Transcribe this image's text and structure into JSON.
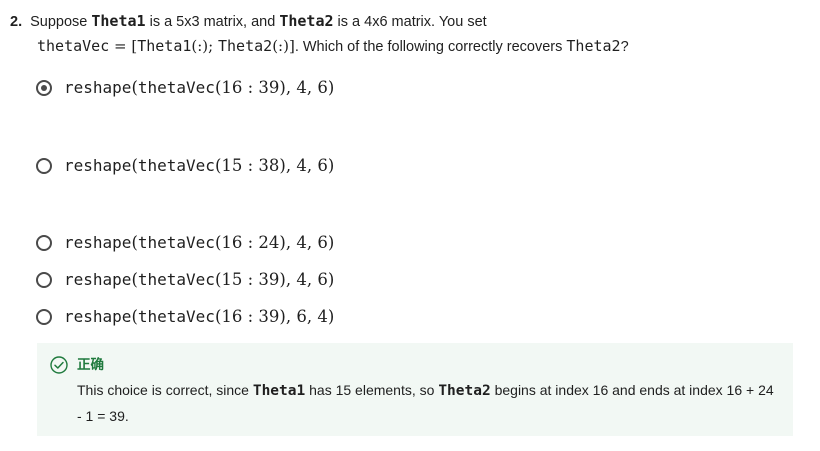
{
  "question": {
    "number": "2.",
    "line1": {
      "t1": "Suppose ",
      "m1": "Theta1",
      "t2": " is a 5x3 matrix, and ",
      "m2": "Theta2",
      "t3": " is a 4x6 matrix. You set"
    },
    "line2": {
      "m_var": "thetaVec",
      "eq": " = ",
      "bracket_open": "[",
      "m_a": "Theta1",
      "colon_a": "(:)",
      "sep": "; ",
      "m_b": "Theta2",
      "colon_b": "(:)",
      "bracket_close": "]",
      "t_end": ". Which of the following correctly recovers ",
      "m_end": "Theta2",
      "q_mark": "?"
    }
  },
  "options": [
    {
      "fn": "reshape",
      "arg_open": "(",
      "var": "thetaVec",
      "range": "(16 : 39), 4, 6)",
      "selected": true
    },
    {
      "fn": "reshape",
      "arg_open": "(",
      "var": "thetaVec",
      "range": "(15 : 38), 4, 6)",
      "selected": false
    },
    {
      "fn": "reshape",
      "arg_open": "(",
      "var": "thetaVec",
      "range": "(16 : 24), 4, 6)",
      "selected": false
    },
    {
      "fn": "reshape",
      "arg_open": "(",
      "var": "thetaVec",
      "range": "(15 : 39), 4, 6)",
      "selected": false
    },
    {
      "fn": "reshape",
      "arg_open": "(",
      "var": "thetaVec",
      "range": "(16 : 39), 6, 4)",
      "selected": false
    }
  ],
  "feedback": {
    "title": "正确",
    "text_a": "This choice is correct, since ",
    "m_a": "Theta1",
    "text_b": " has 15 elements, so ",
    "m_b": "Theta2",
    "text_c": " begins at index 16 and ends at index 16 + 24 - 1 = 39.",
    "accent_color": "#1f7a3d",
    "background_color": "#f2f8f4"
  },
  "icons": {
    "radio_selected": "radio-selected-icon",
    "radio_unselected": "radio-unselected-icon",
    "feedback": "check-circle-icon"
  }
}
